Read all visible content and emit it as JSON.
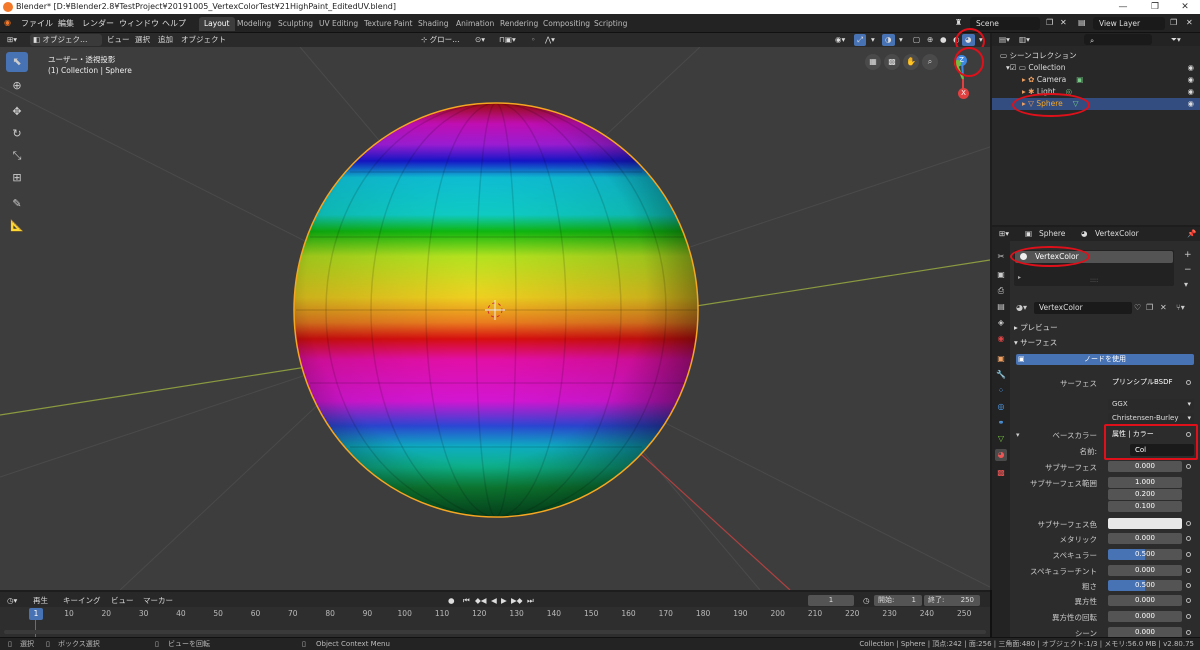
{
  "window": {
    "title": "Blender* [D:¥Blender2.8¥TestProject¥20191005_VertexColorTest¥21HighPaint_EditedUV.blend]",
    "minimize": "—",
    "restore": "❐",
    "close": "✕"
  },
  "menu": [
    "ファイル",
    "編集",
    "レンダー",
    "ウィンドウ",
    "ヘルプ"
  ],
  "workspaces": [
    "Layout",
    "Modeling",
    "Sculpting",
    "UV Editing",
    "Texture Paint",
    "Shading",
    "Animation",
    "Rendering",
    "Compositing",
    "Scripting"
  ],
  "scene": "Scene",
  "view_layer": "View Layer",
  "viewport_header": {
    "mode": "オブジェク…",
    "menus": [
      "ビュー",
      "選択",
      "追加",
      "オブジェクト"
    ],
    "transform": "グロー…"
  },
  "viewport": {
    "view_name": "ユーザー・透視投影",
    "collection_info": "(1) Collection | Sphere"
  },
  "gizmo": {
    "z": "Z",
    "y": "Y",
    "x": "X"
  },
  "outliner": {
    "root": "シーンコレクション",
    "collection": "Collection",
    "items": [
      "Camera",
      "Light",
      "Sphere"
    ]
  },
  "props": {
    "object_name": "Sphere",
    "material_name": "VertexColor",
    "slot": "VertexColor",
    "material_field": "VertexColor",
    "sections": {
      "preview": "プレビュー",
      "surface": "サーフェス"
    },
    "use_nodes": "ノードを使用",
    "surface_label": "サーフェス",
    "surface_value": "プリンシプルBSDF",
    "distribution": "GGX",
    "subsurface_method": "Christensen-Burley",
    "base_color_label": "ベースカラー",
    "base_color_value": "属性 | カラー",
    "name_label": "名前:",
    "name_value": "Col",
    "rows": [
      {
        "label": "サブサーフェス",
        "value": "0.000",
        "blue": false
      },
      {
        "label": "サブサーフェス範囲",
        "value": "1.000",
        "blue": false
      },
      {
        "label": "",
        "value": "0.200",
        "blue": false
      },
      {
        "label": "",
        "value": "0.100",
        "blue": false
      },
      {
        "label": "サブサーフェス色",
        "value": "",
        "blue": false
      },
      {
        "label": "メタリック",
        "value": "0.000",
        "blue": false
      },
      {
        "label": "スペキュラー",
        "value": "0.500",
        "blue": true
      },
      {
        "label": "スペキュラーチント",
        "value": "0.000",
        "blue": false
      },
      {
        "label": "粗さ",
        "value": "0.500",
        "blue": true
      },
      {
        "label": "異方性",
        "value": "0.000",
        "blue": false
      },
      {
        "label": "異方性の回転",
        "value": "0.000",
        "blue": false
      },
      {
        "label": "シーン",
        "value": "0.000",
        "blue": false
      }
    ]
  },
  "timeline": {
    "menus": [
      "再生",
      "キーイング",
      "ビュー",
      "マーカー"
    ],
    "current": "1",
    "start_label": "開始:",
    "start": "1",
    "end_label": "終了:",
    "end": "250",
    "ticks": [
      "1",
      "10",
      "20",
      "30",
      "40",
      "50",
      "60",
      "70",
      "80",
      "90",
      "100",
      "110",
      "120",
      "130",
      "140",
      "150",
      "160",
      "170",
      "180",
      "190",
      "200",
      "210",
      "220",
      "230",
      "240",
      "250"
    ]
  },
  "status": {
    "select": "選択",
    "box_select": "ボックス選択",
    "rotate": "ビューを回転",
    "context": "Object Context Menu",
    "info": "Collection | Sphere | 頂点:242 | 面:256 | 三角面:480 | オブジェクト:1/3 | メモリ:56.0 MB | v2.80.75"
  },
  "colors": {
    "accent": "#4772b3",
    "annotation": "#e0101a",
    "selection_outline": "#f5a623"
  }
}
